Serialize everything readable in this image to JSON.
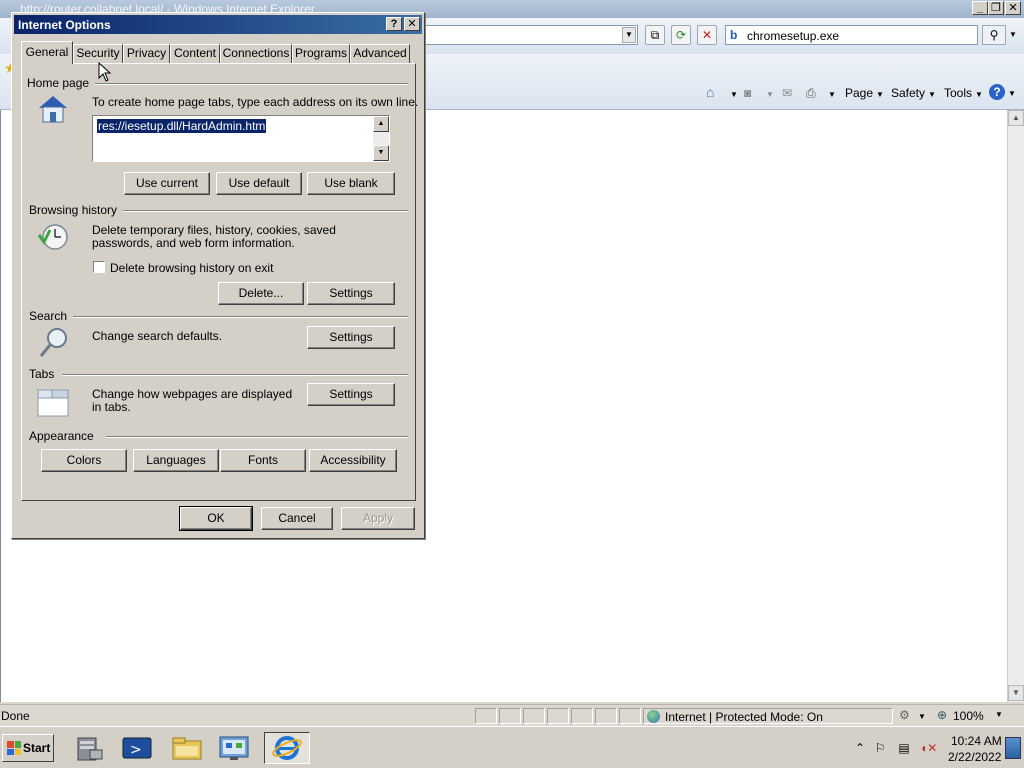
{
  "ie": {
    "window_title": "http://router.collabnet.local/ - Windows Internet Explorer",
    "search_text": "chromesetup.exe",
    "command_bar": {
      "page_label": "Page",
      "safety_label": "Safety",
      "tools_label": "Tools"
    },
    "status": {
      "text": "Done",
      "zone": "Internet | Protected Mode: On",
      "zoom": "100%"
    }
  },
  "dialog": {
    "title": "Internet Options",
    "help_button": "?",
    "close_button": "✕",
    "tabs": [
      {
        "label": "General"
      },
      {
        "label": "Security"
      },
      {
        "label": "Privacy"
      },
      {
        "label": "Content"
      },
      {
        "label": "Connections"
      },
      {
        "label": "Programs"
      },
      {
        "label": "Advanced"
      }
    ],
    "selected_tab": "General",
    "home_page": {
      "group_label": "Home page",
      "description": "To create home page tabs, type each address on its own line.",
      "value": "res://iesetup.dll/HardAdmin.htm",
      "use_current": "Use current",
      "use_default": "Use default",
      "use_blank": "Use blank"
    },
    "browsing_history": {
      "group_label": "Browsing history",
      "description": "Delete temporary files, history, cookies, saved passwords, and web form information.",
      "checkbox_label": "Delete browsing history on exit",
      "checkbox_checked": false,
      "delete_button": "Delete...",
      "settings_button": "Settings"
    },
    "search": {
      "group_label": "Search",
      "description": "Change search defaults.",
      "settings_button": "Settings"
    },
    "tabs_section": {
      "group_label": "Tabs",
      "description": "Change how webpages are displayed in tabs.",
      "settings_button": "Settings"
    },
    "appearance": {
      "group_label": "Appearance",
      "colors": "Colors",
      "languages": "Languages",
      "fonts": "Fonts",
      "accessibility": "Accessibility"
    },
    "ok": "OK",
    "cancel": "Cancel",
    "apply": "Apply"
  },
  "taskbar": {
    "start_label": "Start",
    "clock_time": "10:24 AM",
    "clock_date": "2/22/2022"
  },
  "colors": {
    "dialog_title_start": "#0a246a",
    "dialog_title_end": "#3a6ea5",
    "selection": "#0a246a"
  }
}
